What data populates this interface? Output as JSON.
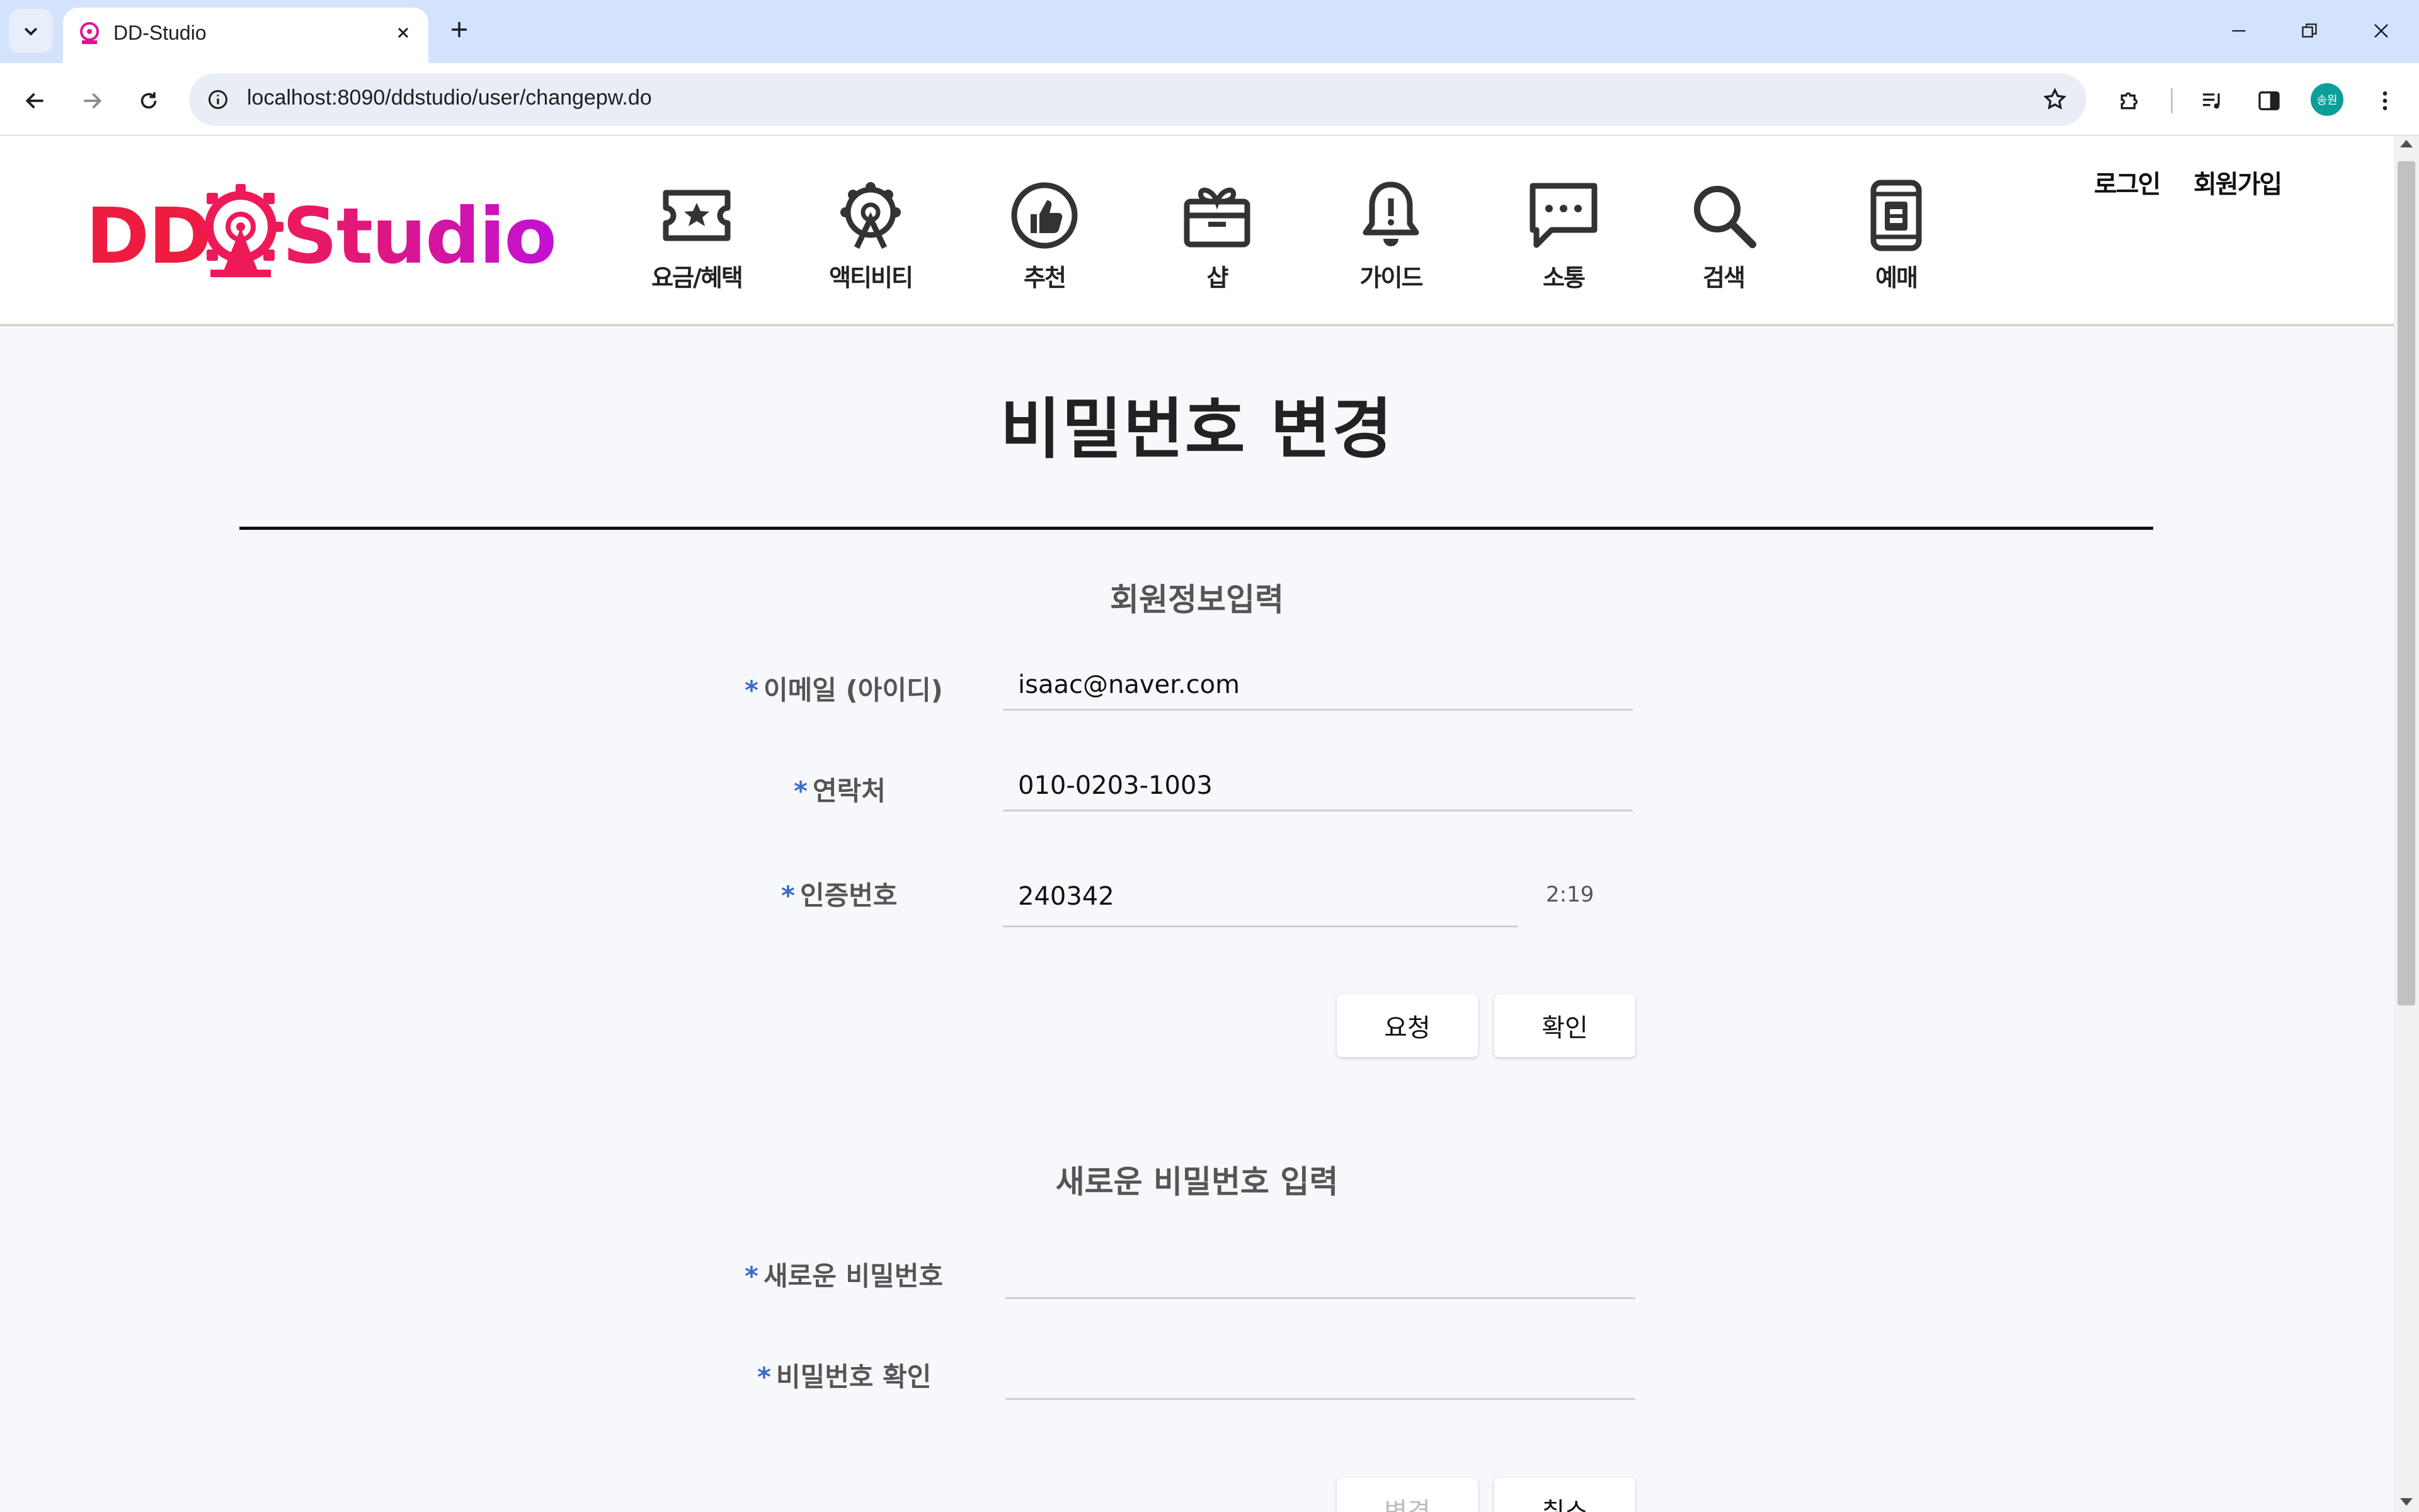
{
  "browser": {
    "tab_title": "DD-Studio",
    "url": "localhost:8090/ddstudio/user/changepw.do",
    "profile_initials": "송원"
  },
  "site": {
    "logo_dd": "DD",
    "logo_studio": "Studio",
    "nav": [
      {
        "label": "요금/혜택",
        "icon": "ticket-star-icon"
      },
      {
        "label": "액티비티",
        "icon": "ferris-wheel-icon"
      },
      {
        "label": "추천",
        "icon": "thumbs-up-icon"
      },
      {
        "label": "샵",
        "icon": "gift-box-icon"
      },
      {
        "label": "가이드",
        "icon": "bell-alert-icon"
      },
      {
        "label": "소통",
        "icon": "chat-bubble-icon"
      },
      {
        "label": "검색",
        "icon": "search-icon"
      },
      {
        "label": "예매",
        "icon": "mobile-ticket-icon"
      }
    ],
    "login": "로그인",
    "signup": "회원가입"
  },
  "page": {
    "title": "비밀번호 변경",
    "member_section": {
      "title": "회원정보입력",
      "email_label": "이메일 (아이디)",
      "email_value": "isaac@naver.com",
      "phone_label": "연락처",
      "phone_value": "010-0203-1003",
      "code_label": "인증번호",
      "code_value": "240342",
      "timer": "2:19",
      "request_button": "요청",
      "confirm_button": "확인"
    },
    "password_section": {
      "title": "새로운 비밀번호 입력",
      "new_password_label": "새로운 비밀번호",
      "new_password_value": "",
      "confirm_password_label": "비밀번호 확인",
      "confirm_password_value": "",
      "change_button": "변경",
      "cancel_button": "취소"
    },
    "required_mark": "*"
  },
  "colors": {
    "accent_red": "#ee1c40",
    "accent_magenta": "#c210d6",
    "required_blue": "#3b6cc8"
  }
}
